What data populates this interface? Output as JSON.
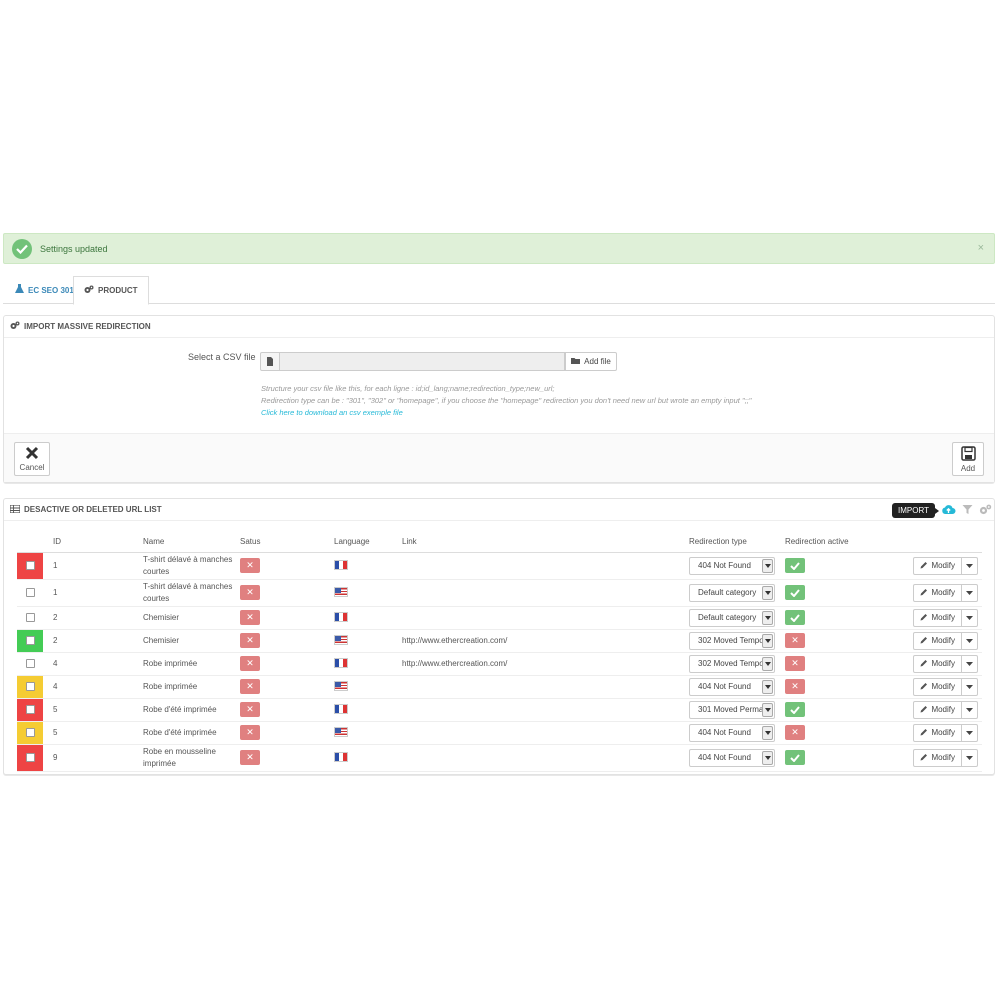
{
  "alert": {
    "message": "Settings updated",
    "close": "×"
  },
  "tabs": [
    {
      "label": "EC SEO 301",
      "icon": "flask-icon"
    },
    {
      "label": "PRODUCT",
      "icon": "cogs-icon"
    }
  ],
  "import_panel": {
    "title": "IMPORT MASSIVE REDIRECTION",
    "csv_label": "Select a CSV file",
    "add_file_label": "Add file",
    "help_line1": "Structure your csv file like this, for each ligne : id;id_lang;name;redirection_type;new_url;",
    "help_line2": "Redirection type can be : \"301\", \"302\" or \"homepage\", if you choose the \"homepage\" redirection you don't need new url but wrote an empty input \";;\"",
    "download_link": "Click here to download an csv exemple file",
    "cancel_label": "Cancel",
    "add_label": "Add"
  },
  "list_panel": {
    "title": "DESACTIVE OR DELETED URL LIST",
    "import_tooltip": "IMPORT",
    "columns": [
      "ID",
      "Name",
      "Satus",
      "Language",
      "Link",
      "Redirection type",
      "Redirection active"
    ],
    "modify_label": "Modify",
    "rows": [
      {
        "id": "1",
        "name": "T-shirt délavé à manches courtes",
        "status": "inactive",
        "language": "fr",
        "link": "",
        "redirection_type": "404 Not Found",
        "active": true,
        "marker_color": "#ee4444"
      },
      {
        "id": "1",
        "name": "T-shirt délavé à manches courtes",
        "status": "inactive",
        "language": "us",
        "link": "",
        "redirection_type": "Default category",
        "active": true,
        "marker_color": ""
      },
      {
        "id": "2",
        "name": "Chemisier",
        "status": "inactive",
        "language": "fr",
        "link": "",
        "redirection_type": "Default category",
        "active": true,
        "marker_color": ""
      },
      {
        "id": "2",
        "name": "Chemisier",
        "status": "inactive",
        "language": "us",
        "link": "http://www.ethercreation.com/",
        "redirection_type": "302 Moved Temporarily",
        "active": false,
        "marker_color": "#44cc55"
      },
      {
        "id": "4",
        "name": "Robe imprimée",
        "status": "inactive",
        "language": "fr",
        "link": "http://www.ethercreation.com/",
        "redirection_type": "302 Moved Temporarily",
        "active": false,
        "marker_color": ""
      },
      {
        "id": "4",
        "name": "Robe imprimée",
        "status": "inactive",
        "language": "us",
        "link": "",
        "redirection_type": "404 Not Found",
        "active": false,
        "marker_color": "#f5cc33"
      },
      {
        "id": "5",
        "name": "Robe d'été imprimée",
        "status": "inactive",
        "language": "fr",
        "link": "",
        "redirection_type": "301 Moved Permanently",
        "active": true,
        "marker_color": "#ee4444"
      },
      {
        "id": "5",
        "name": "Robe d'été imprimée",
        "status": "inactive",
        "language": "us",
        "link": "",
        "redirection_type": "404 Not Found",
        "active": false,
        "marker_color": "#f5cc33"
      },
      {
        "id": "9",
        "name": "Robe en mousseline imprimée",
        "status": "inactive",
        "language": "fr",
        "link": "",
        "redirection_type": "404 Not Found",
        "active": true,
        "marker_color": "#ee4444"
      }
    ]
  }
}
